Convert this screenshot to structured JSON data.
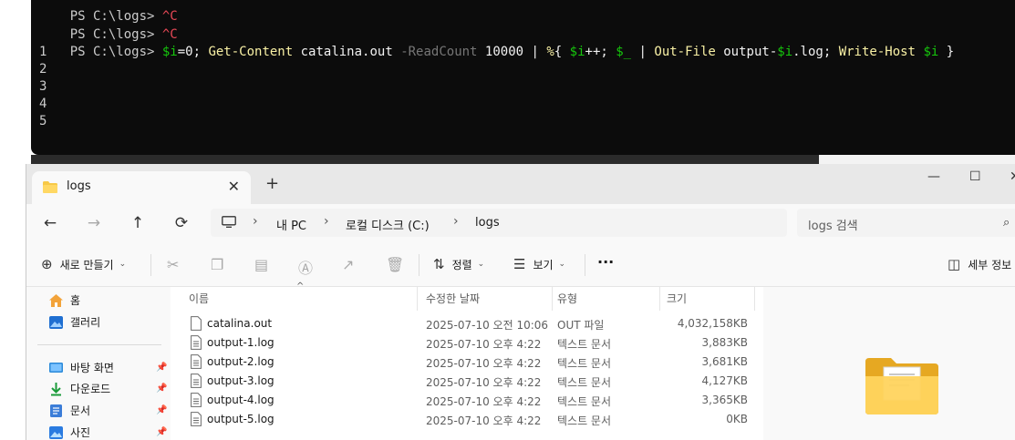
{
  "terminal": {
    "line0": "PS C:\\logs> ^C",
    "line1_prompt": "PS C:\\logs> ",
    "line1_cmd": "^C",
    "cmd": {
      "prompt": "PS C:\\logs> ",
      "tokens": [
        {
          "t": "$i",
          "c": "var"
        },
        {
          "t": "=0; ",
          "c": "white"
        },
        {
          "t": "Get-Content",
          "c": "yellow"
        },
        {
          "t": " catalina.out ",
          "c": "white"
        },
        {
          "t": "-ReadCount",
          "c": "gray"
        },
        {
          "t": " 10000 ",
          "c": "white"
        },
        {
          "t": "| ",
          "c": "white"
        },
        {
          "t": "%",
          "c": "yellow"
        },
        {
          "t": "{ ",
          "c": "white"
        },
        {
          "t": "$i",
          "c": "var"
        },
        {
          "t": "++; ",
          "c": "white"
        },
        {
          "t": "$_",
          "c": "var"
        },
        {
          "t": " | ",
          "c": "white"
        },
        {
          "t": "Out-File",
          "c": "yellow"
        },
        {
          "t": " output-",
          "c": "white"
        },
        {
          "t": "$i",
          "c": "var"
        },
        {
          "t": ".log; ",
          "c": "white"
        },
        {
          "t": "Write-Host",
          "c": "yellow"
        },
        {
          "t": " ",
          "c": "white"
        },
        {
          "t": "$i",
          "c": "var"
        },
        {
          "t": " }",
          "c": "white"
        }
      ]
    },
    "output": [
      "1",
      "2",
      "3",
      "4",
      "5"
    ],
    "colors": {
      "background": "#0c0c0c",
      "yellow": "#f9f1a5",
      "var": "#16c60c",
      "gray": "#767676",
      "red": "#e74856",
      "white": "#f2f2f2"
    }
  },
  "explorer": {
    "tab": {
      "label": "logs",
      "close": "✕",
      "new_tab": "+"
    },
    "window_controls": {
      "minimize": "—",
      "maximize": "☐",
      "close": "✕"
    },
    "nav": {
      "back": "←",
      "forward": "→",
      "up": "↑",
      "refresh": "⟳"
    },
    "address": {
      "crumbs": [
        "내 PC",
        "로컬 디스크 (C:)",
        "logs"
      ]
    },
    "search": {
      "placeholder": "logs 검색"
    },
    "commands": {
      "new": "새로 만들기",
      "sort": "정렬",
      "view": "보기",
      "more": "···",
      "details": "세부 정보"
    },
    "sidebar": {
      "items": [
        {
          "label": "홈",
          "icon": "home-icon"
        },
        {
          "label": "갤러리",
          "icon": "gallery-icon"
        },
        {
          "label": "바탕 화면",
          "icon": "desktop-icon",
          "pinned": true
        },
        {
          "label": "다운로드",
          "icon": "download-icon",
          "pinned": true
        },
        {
          "label": "문서",
          "icon": "document-icon",
          "pinned": true
        },
        {
          "label": "사진",
          "icon": "pictures-icon",
          "pinned": true
        }
      ]
    },
    "columns": {
      "name": "이름",
      "modified": "수정한 날짜",
      "type": "유형",
      "size": "크기"
    },
    "files": [
      {
        "name": "catalina.out",
        "modified": "2025-07-10 오전 10:06",
        "type": "OUT 파일",
        "size": "4,032,158KB"
      },
      {
        "name": "output-1.log",
        "modified": "2025-07-10 오후 4:22",
        "type": "텍스트 문서",
        "size": "3,883KB"
      },
      {
        "name": "output-2.log",
        "modified": "2025-07-10 오후 4:22",
        "type": "텍스트 문서",
        "size": "3,681KB"
      },
      {
        "name": "output-3.log",
        "modified": "2025-07-10 오후 4:22",
        "type": "텍스트 문서",
        "size": "4,127KB"
      },
      {
        "name": "output-4.log",
        "modified": "2025-07-10 오후 4:22",
        "type": "텍스트 문서",
        "size": "3,365KB"
      },
      {
        "name": "output-5.log",
        "modified": "2025-07-10 오후 4:22",
        "type": "텍스트 문서",
        "size": "0KB"
      }
    ],
    "colors": {
      "folder": "#f7c948",
      "accent": "#0067c0"
    }
  }
}
